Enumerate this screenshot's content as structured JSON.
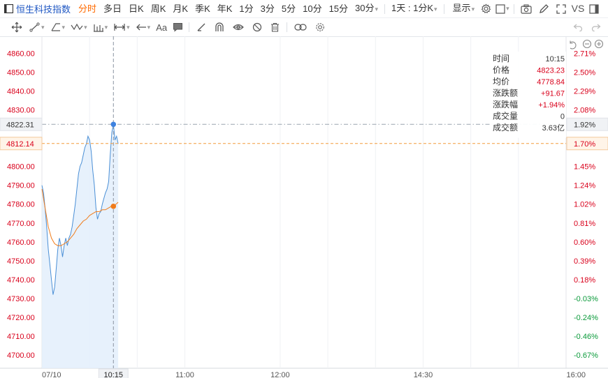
{
  "toolbar": {
    "title": "恒生科技指数",
    "period_tabs": [
      "分时",
      "多日",
      "日K",
      "周K",
      "月K",
      "季K",
      "年K",
      "1分",
      "3分",
      "5分",
      "10分",
      "15分"
    ],
    "more_period": "30分",
    "interval_select": "1天 : 1分K",
    "display_label": "显示",
    "vs_label": "VS"
  },
  "toolbar2": {
    "text_tool_label": "Aa"
  },
  "tooltip": {
    "rows": [
      {
        "label": "时间",
        "value": "10:15",
        "color": "#333333"
      },
      {
        "label": "价格",
        "value": "4823.23",
        "color": "#d9001b"
      },
      {
        "label": "均价",
        "value": "4778.84",
        "color": "#d9001b"
      },
      {
        "label": "涨跌额",
        "value": "+91.67",
        "color": "#d9001b"
      },
      {
        "label": "涨跌幅",
        "value": "+1.94%",
        "color": "#d9001b"
      },
      {
        "label": "成交量",
        "value": "0",
        "color": "#333333"
      },
      {
        "label": "成交额",
        "value": "3.63亿",
        "color": "#333333"
      }
    ]
  },
  "chart_data": {
    "type": "line",
    "title": "",
    "ylabel": "",
    "xlabel": "",
    "ylim": [
      4693,
      4869
    ],
    "prev_close": 4731.56,
    "y_ticks": [
      4860.0,
      4850.0,
      4840.0,
      4830.0,
      4800.0,
      4790.0,
      4780.0,
      4770.0,
      4760.0,
      4750.0,
      4740.0,
      4730.0,
      4720.0,
      4710.0,
      4700.0
    ],
    "right_ticks_up": [
      "2.71%",
      "2.50%",
      "2.29%",
      "2.08%",
      "1.45%",
      "1.24%",
      "1.02%",
      "0.81%",
      "0.60%",
      "0.39%",
      "0.18%"
    ],
    "right_ticks_up_values": [
      4860,
      4850,
      4840,
      4830,
      4800,
      4790,
      4780,
      4770,
      4760,
      4750,
      4740
    ],
    "right_ticks_down": [
      "-0.03%",
      "-0.24%",
      "-0.46%",
      "-0.67%"
    ],
    "right_ticks_down_values": [
      4730,
      4720,
      4710,
      4700
    ],
    "x_labels": [
      {
        "label": "07/10",
        "time": "09:30"
      },
      {
        "label": "11:00",
        "time": "11:00"
      },
      {
        "label": "12:00",
        "time": "13:00"
      },
      {
        "label": "14:30",
        "time": "14:30"
      },
      {
        "label": "16:00",
        "time": "16:00"
      }
    ],
    "x_range_minutes": [
      0,
      330
    ],
    "grid_minutes": [
      30,
      60,
      90,
      150,
      180,
      210,
      240,
      270,
      300
    ],
    "crosshair": {
      "time": "10:15",
      "minute": 45,
      "price": 4822.31,
      "pct": "1.92%"
    },
    "current": {
      "price": 4812.14,
      "pct": "1.70%"
    },
    "series": [
      {
        "role": "price",
        "color": "#4a8fd6",
        "points": [
          [
            0,
            4790
          ],
          [
            1,
            4786
          ],
          [
            2,
            4778
          ],
          [
            3,
            4768
          ],
          [
            4,
            4756
          ],
          [
            5,
            4748
          ],
          [
            6,
            4740
          ],
          [
            7,
            4732
          ],
          [
            8,
            4736
          ],
          [
            9,
            4746
          ],
          [
            10,
            4756
          ],
          [
            11,
            4762
          ],
          [
            12,
            4758
          ],
          [
            13,
            4752
          ],
          [
            14,
            4758
          ],
          [
            15,
            4762
          ],
          [
            16,
            4758
          ],
          [
            17,
            4762
          ],
          [
            18,
            4764
          ],
          [
            19,
            4768
          ],
          [
            20,
            4774
          ],
          [
            21,
            4780
          ],
          [
            22,
            4788
          ],
          [
            23,
            4796
          ],
          [
            24,
            4800
          ],
          [
            25,
            4802
          ],
          [
            26,
            4806
          ],
          [
            27,
            4810
          ],
          [
            28,
            4812
          ],
          [
            29,
            4816
          ],
          [
            30,
            4814
          ],
          [
            31,
            4808
          ],
          [
            32,
            4798
          ],
          [
            33,
            4790
          ],
          [
            34,
            4778
          ],
          [
            35,
            4772
          ],
          [
            36,
            4775
          ],
          [
            37,
            4776
          ],
          [
            38,
            4780
          ],
          [
            39,
            4783
          ],
          [
            40,
            4786
          ],
          [
            41,
            4788
          ],
          [
            42,
            4792
          ],
          [
            43,
            4806
          ],
          [
            44,
            4818
          ],
          [
            45,
            4822.31
          ],
          [
            46,
            4814
          ],
          [
            47,
            4816
          ],
          [
            48,
            4812
          ]
        ]
      },
      {
        "role": "average",
        "color": "#f07c1b",
        "points": [
          [
            0,
            4788
          ],
          [
            2,
            4778
          ],
          [
            4,
            4768
          ],
          [
            6,
            4762
          ],
          [
            8,
            4759
          ],
          [
            10,
            4758
          ],
          [
            12,
            4758
          ],
          [
            14,
            4759
          ],
          [
            16,
            4760
          ],
          [
            18,
            4762
          ],
          [
            20,
            4764
          ],
          [
            22,
            4767
          ],
          [
            24,
            4769
          ],
          [
            26,
            4771
          ],
          [
            28,
            4772
          ],
          [
            30,
            4774
          ],
          [
            32,
            4775
          ],
          [
            34,
            4776
          ],
          [
            36,
            4776
          ],
          [
            38,
            4777
          ],
          [
            40,
            4777
          ],
          [
            42,
            4778
          ],
          [
            44,
            4779
          ],
          [
            45,
            4778.84
          ],
          [
            46,
            4779.5
          ],
          [
            48,
            4781
          ]
        ]
      }
    ]
  }
}
